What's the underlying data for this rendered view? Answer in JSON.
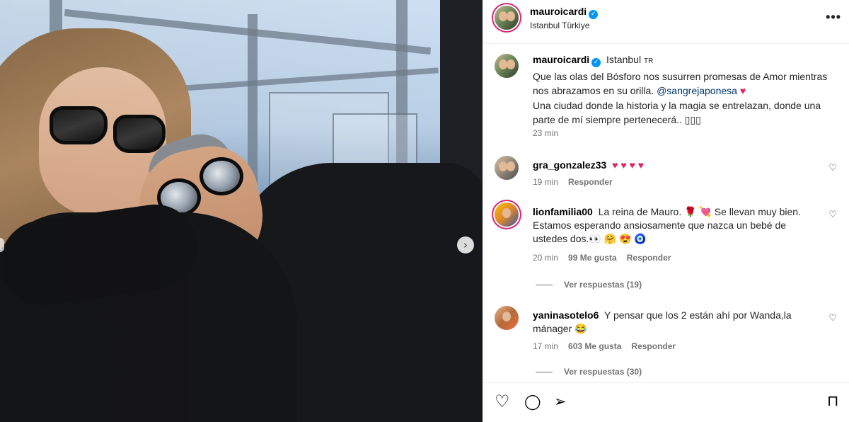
{
  "post": {
    "username": "mauroicardi",
    "location": "Istanbul Türkiye",
    "verified_icon": "verified-badge-icon",
    "photo_alt": "Couple wearing sunglasses embracing in a glass pavilion"
  },
  "caption": {
    "username": "mauroicardi",
    "location": "Istanbul",
    "location_flag": "TR",
    "line1": "Que las olas del Bósforo nos susurren promesas de Amor mientras nos abrazamos en su orilla.",
    "mention": "@sangrejaponesa",
    "heart": "♥",
    "line2": "Una ciudad donde la historia y la magia se entrelazan, donde una parte de mí siempre pertenecerá.. ▯▯▯",
    "time": "23 min"
  },
  "comments": [
    {
      "username": "gra_gonzalez33",
      "text": "♥ ♥ ♥ ♥",
      "time": "19 min",
      "likes": "",
      "reply": "Responder"
    },
    {
      "username": "lionfamilia00",
      "text": "La reina de Mauro. 🌹 💘 Se llevan muy bien. Estamos esperando ansiosamente que nazca un bebé de ustedes dos.👀 🤗 😍 🧿",
      "time": "20 min",
      "likes": "99 Me gusta",
      "reply": "Responder",
      "view_replies": "Ver respuestas (19)"
    },
    {
      "username": "yaninasotelo6",
      "text": "Y pensar que los 2 están ahí por Wanda,la mánager 😂",
      "time": "17 min",
      "likes": "603 Me gusta",
      "reply": "Responder",
      "view_replies": "Ver respuestas (30)"
    }
  ],
  "icons": {
    "more": "more-options-icon",
    "like": "heart-icon",
    "comment": "comment-icon",
    "share": "share-icon",
    "save": "bookmark-icon",
    "next": "chevron-right-icon"
  },
  "glyphs": {
    "more": "•••",
    "like": "♡",
    "comment": "◯",
    "share": "➢",
    "save": "⊓",
    "next": "›",
    "comment_like": "♡",
    "verified": "✓"
  },
  "colors": {
    "link": "#00376b",
    "verified": "#0095f6",
    "muted": "#737373",
    "heart": "#e0245e"
  }
}
